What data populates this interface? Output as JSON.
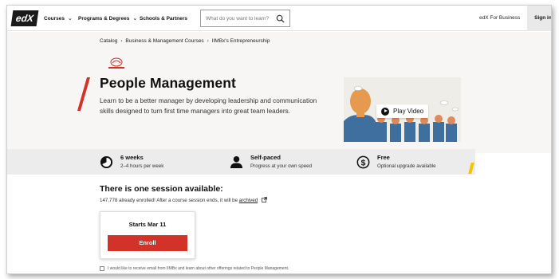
{
  "header": {
    "logo": "edX",
    "nav": [
      {
        "label": "Courses"
      },
      {
        "label": "Programs & Degrees"
      },
      {
        "label": "Schools & Partners"
      }
    ],
    "search_placeholder": "What do you want to learn?",
    "business_label": "edX For Business",
    "signin_label": "Sign in"
  },
  "breadcrumb": [
    "Catalog",
    "Business & Management Courses",
    "IIMBx's Entrepreneurship"
  ],
  "course": {
    "title": "People Management",
    "description": "Learn to be a better manager by developing leadership and communication skills designed to turn first time managers into great team leaders.",
    "play_label": "Play Video"
  },
  "stats": [
    {
      "icon": "clock-icon",
      "title": "6 weeks",
      "subtitle": "2–4 hours per week"
    },
    {
      "icon": "person-icon",
      "title": "Self-paced",
      "subtitle": "Progress at your own speed"
    },
    {
      "icon": "dollar-icon",
      "title": "Free",
      "subtitle": "Optional upgrade available"
    }
  ],
  "session": {
    "heading": "There is one session available:",
    "enrolled_text": "147,778 already enrolled! After a course session ends, it will be",
    "archived_link": "archived",
    "starts": "Starts Mar 11",
    "enroll_label": "Enroll"
  },
  "consent_text": "I would like to receive email from IIMBx and learn about other offerings related to People Management.",
  "colors": {
    "accent_red": "#d23228",
    "accent_yellow": "#f3c400",
    "hero_bg": "#f7f6f4",
    "stats_bg": "#ececec"
  }
}
